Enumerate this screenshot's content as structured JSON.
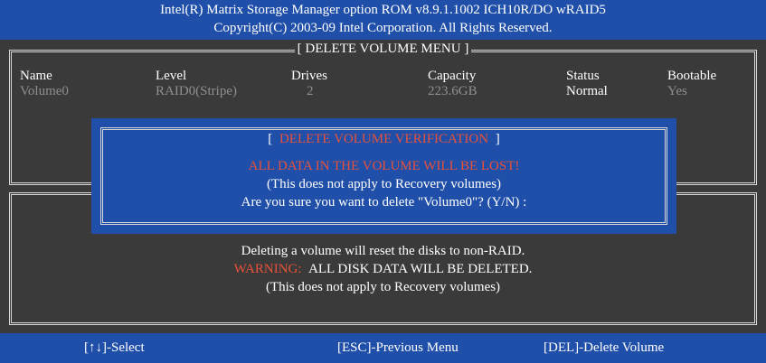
{
  "header": {
    "line1": "Intel(R) Matrix Storage Manager option ROM v8.9.1.1002 ICH10R/DO wRAID5",
    "line2": "Copyright(C) 2003-09 Intel Corporation.  All Rights Reserved."
  },
  "menu": {
    "title": "[ DELETE VOLUME MENU ]",
    "columns": [
      "Name",
      "Level",
      "Drives",
      "Capacity",
      "Status",
      "Bootable"
    ],
    "row": {
      "name": "Volume0",
      "level": "RAID0(Stripe)",
      "drives": "2",
      "capacity": "223.6GB",
      "status": "Normal",
      "bootable": "Yes"
    }
  },
  "dialog": {
    "title_open": "[ ",
    "title": "DELETE VOLUME VERIFICATION",
    "title_close": " ]",
    "warning": "ALL DATA IN THE VOLUME WILL BE LOST!",
    "note": "(This does not apply to Recovery volumes)",
    "prompt": "Are you sure you want to delete \"Volume0\"? (Y/N) :"
  },
  "info": {
    "line1": "Deleting a volume will reset the disks to non-RAID.",
    "warning_label": "WARNING:",
    "warning_text": "ALL DISK DATA WILL BE DELETED.",
    "line3": "(This does not apply to Recovery volumes)"
  },
  "footer": {
    "select": "[↑↓]-Select",
    "previous": "[ESC]-Previous Menu",
    "delete": "[DEL]-Delete Volume"
  },
  "colors": {
    "background": "#3a3a3a",
    "bar_blue": "#1f4fa8",
    "warning_red": "#e8513a",
    "dim_text": "#8f8f8f"
  }
}
